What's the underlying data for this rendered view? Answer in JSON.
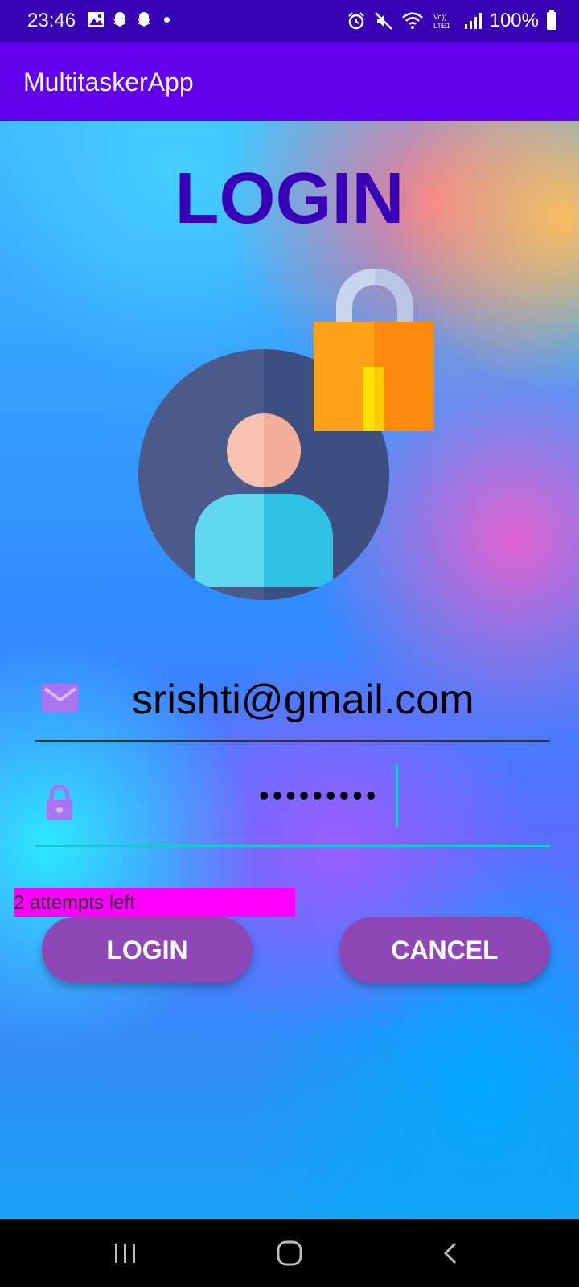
{
  "status_bar": {
    "time": "23:46",
    "battery": "100%",
    "left_icons": [
      "image-icon",
      "snapchat-icon",
      "snapchat-icon",
      "dot"
    ],
    "right_icons": [
      "alarm-icon",
      "mute-icon",
      "wifi-icon",
      "volte-icon",
      "signal-icon",
      "battery-icon"
    ]
  },
  "app_bar": {
    "title": "MultitaskerApp"
  },
  "login": {
    "heading": "LOGIN",
    "email_value": "srishti@gmail.com",
    "password_value": "•••••••••",
    "attempts_text": "2 attempts left",
    "login_button": "LOGIN",
    "cancel_button": "CANCEL"
  },
  "colors": {
    "status_bar": "#3700b3",
    "app_bar": "#6200ee",
    "heading": "#3a00b8",
    "button": "#8f47b6",
    "attempts_bg": "#ff00ff",
    "field_icon": "#a974ef",
    "active_underline": "#19c7d3"
  },
  "nav_bar": {
    "icons": [
      "recents-icon",
      "home-icon",
      "back-icon"
    ]
  }
}
